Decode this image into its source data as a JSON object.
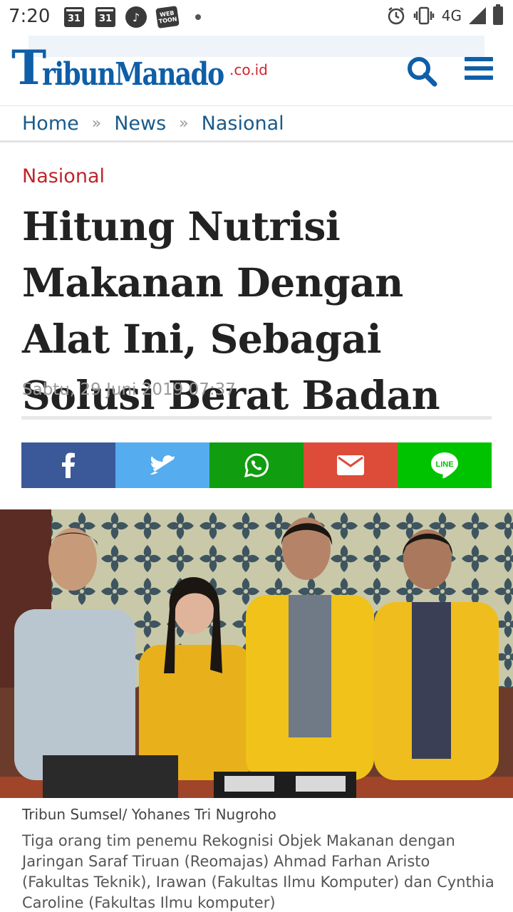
{
  "status_bar": {
    "time": "7:20",
    "calendar_1": "31",
    "calendar_2": "31",
    "webtoon": "WEB TOON",
    "network": "4G"
  },
  "header": {
    "logo_t": "T",
    "logo_text": "ribunManado",
    "logo_suffix": ".co.id",
    "brand_color": "#0f5ea8",
    "accent_color": "#d3232a"
  },
  "breadcrumb": {
    "items": [
      "Home",
      "News",
      "Nasional"
    ],
    "separator": "»"
  },
  "article": {
    "category": "Nasional",
    "title": "Hitung Nutrisi Makanan Dengan Alat Ini, Sebagai Solusi Berat Badan",
    "date": "Sabtu, 29 Juni 2019 07:37"
  },
  "share": {
    "buttons": [
      {
        "name": "facebook",
        "color": "#3b5998",
        "icon": "facebook-icon"
      },
      {
        "name": "twitter",
        "color": "#55acee",
        "icon": "twitter-icon"
      },
      {
        "name": "whatsapp",
        "color": "#109d0f",
        "icon": "whatsapp-icon"
      },
      {
        "name": "email",
        "color": "#dd4b39",
        "icon": "mail-icon"
      },
      {
        "name": "line",
        "color": "#00c300",
        "icon": "line-icon",
        "label": "LINE"
      }
    ]
  },
  "photo": {
    "credit": "Tribun Sumsel/ Yohanes Tri Nugroho",
    "caption": "Tiga orang tim penemu Rekognisi Objek Makanan dengan Jaringan Saraf Tiruan (Reomajas) Ahmad Farhan Aristo (Fakultas Teknik), Irawan (Fakultas Ilmu Komputer) dan Cynthia Caroline (Fakultas Ilmu komputer)"
  }
}
